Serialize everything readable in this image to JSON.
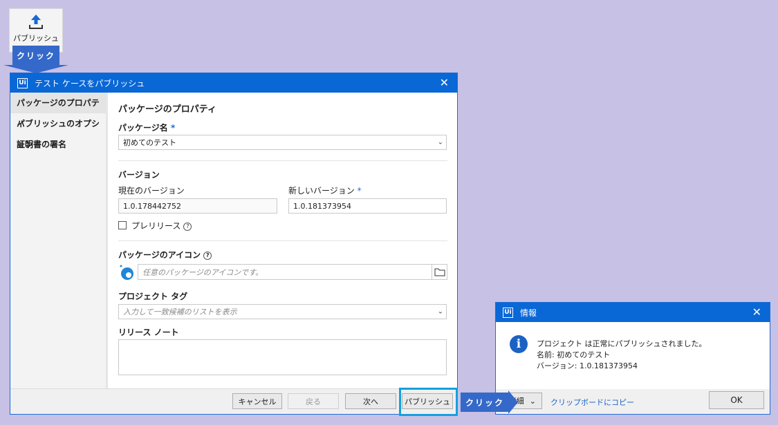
{
  "toolbar": {
    "publish_label": "パブリッシュ",
    "publish_icon": "upload-icon"
  },
  "callouts": {
    "click_top": "クリック",
    "click_bottom": "クリック"
  },
  "dialog": {
    "title": "テスト ケースをパブリッシュ",
    "logo": "Ui",
    "sidebar": [
      {
        "label": "パッケージのプロパティ",
        "active": true
      },
      {
        "label": "パブリッシュのオプション",
        "active": false
      },
      {
        "label": "証明書の署名",
        "active": false
      }
    ],
    "section_title": "パッケージのプロパティ",
    "package_name": {
      "label": "パッケージ名",
      "required": "*",
      "value": "初めてのテスト"
    },
    "version": {
      "title": "バージョン",
      "current_label": "現在のバージョン",
      "current_value": "1.0.178442752",
      "new_label": "新しいバージョン",
      "new_required": "*",
      "new_value": "1.0.181373954",
      "prerelease_label": "プレリリース",
      "help": "?"
    },
    "icon": {
      "label": "パッケージのアイコン",
      "help": "?",
      "placeholder": "任意のパッケージのアイコンです。"
    },
    "tags": {
      "label": "プロジェクト タグ",
      "placeholder": "入力して一致候補のリストを表示"
    },
    "release_notes": {
      "label": "リリース ノート",
      "value": ""
    },
    "buttons": {
      "cancel": "キャンセル",
      "back": "戻る",
      "next": "次へ",
      "publish": "パブリッシュ"
    }
  },
  "info": {
    "title": "情報",
    "logo": "Ui",
    "message_line1": "プロジェクト は正常にパブリッシュされました。",
    "message_line2": "名前: 初めてのテスト",
    "message_line3": "バージョン: 1.0.181373954",
    "details_button": "詳細",
    "copy_link": "クリップボードにコピー",
    "ok_button": "OK"
  },
  "colors": {
    "accent": "#0a67d6",
    "background": "#c7c1e5",
    "callout": "#3569c9",
    "highlight": "#14a0de"
  }
}
